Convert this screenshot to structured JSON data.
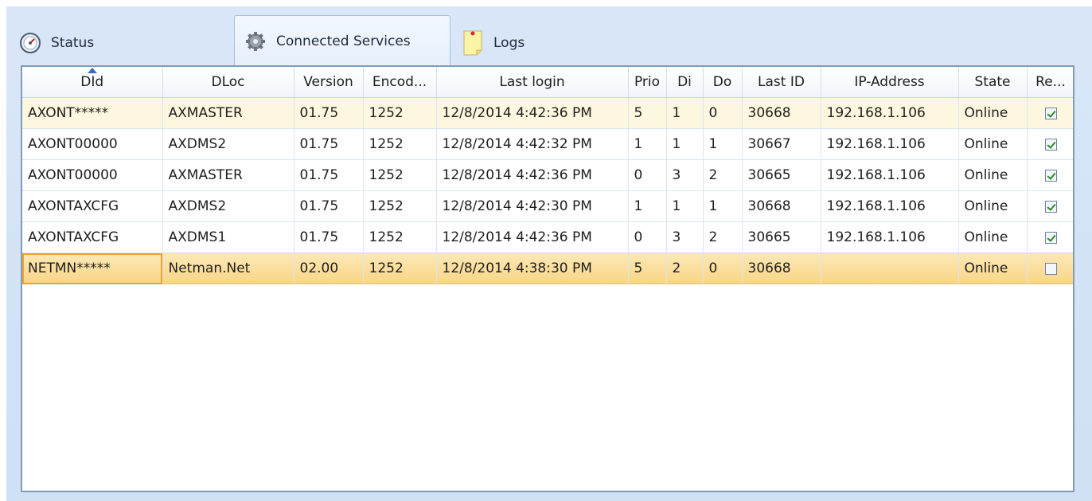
{
  "tabs": [
    {
      "label": "Status",
      "icon": "speedometer-icon"
    },
    {
      "label": "Connected Services",
      "icon": "gear-icon",
      "active": true
    },
    {
      "label": "Logs",
      "icon": "sticky-note-icon"
    }
  ],
  "grid": {
    "columns": [
      "DId",
      "DLoc",
      "Version",
      "Encod...",
      "Last login",
      "Prio",
      "Di",
      "Do",
      "Last ID",
      "IP-Address",
      "State",
      "Re..."
    ],
    "sorted_column": "DId",
    "rows": [
      {
        "did": "AXONT*****",
        "dloc": "AXMASTER",
        "version": "01.75",
        "encod": "1252",
        "last_login": "12/8/2014 4:42:36 PM",
        "prio": "5",
        "di": "1",
        "do": "0",
        "last_id": "30668",
        "ip": "192.168.1.106",
        "state": "Online",
        "re": true
      },
      {
        "did": "AXONT00000",
        "dloc": "AXDMS2",
        "version": "01.75",
        "encod": "1252",
        "last_login": "12/8/2014 4:42:32 PM",
        "prio": "1",
        "di": "1",
        "do": "1",
        "last_id": "30667",
        "ip": "192.168.1.106",
        "state": "Online",
        "re": true
      },
      {
        "did": "AXONT00000",
        "dloc": "AXMASTER",
        "version": "01.75",
        "encod": "1252",
        "last_login": "12/8/2014 4:42:36 PM",
        "prio": "0",
        "di": "3",
        "do": "2",
        "last_id": "30665",
        "ip": "192.168.1.106",
        "state": "Online",
        "re": true
      },
      {
        "did": "AXONTAXCFG",
        "dloc": "AXDMS2",
        "version": "01.75",
        "encod": "1252",
        "last_login": "12/8/2014 4:42:30 PM",
        "prio": "1",
        "di": "1",
        "do": "1",
        "last_id": "30668",
        "ip": "192.168.1.106",
        "state": "Online",
        "re": true
      },
      {
        "did": "AXONTAXCFG",
        "dloc": "AXDMS1",
        "version": "01.75",
        "encod": "1252",
        "last_login": "12/8/2014 4:42:36 PM",
        "prio": "0",
        "di": "3",
        "do": "2",
        "last_id": "30665",
        "ip": "192.168.1.106",
        "state": "Online",
        "re": true
      },
      {
        "did": "NETMN*****",
        "dloc": "Netman.Net",
        "version": "02.00",
        "encod": "1252",
        "last_login": "12/8/2014 4:38:30 PM",
        "prio": "5",
        "di": "2",
        "do": "0",
        "last_id": "30668",
        "ip": "",
        "state": "Online",
        "re": false
      }
    ]
  },
  "colors": {
    "accent": "#3a6fb5",
    "selection": "#f9d587",
    "focus": "#f0a030",
    "frame": "#cfe0f5"
  }
}
